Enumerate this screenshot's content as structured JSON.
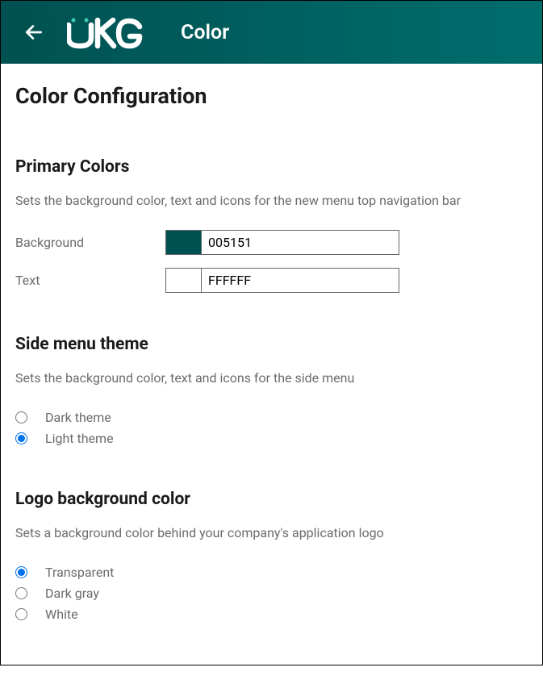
{
  "header": {
    "title": "Color",
    "brand_color": "#005151"
  },
  "page": {
    "title": "Color Configuration"
  },
  "sections": {
    "primary": {
      "title": "Primary Colors",
      "desc": "Sets the background color, text and icons for the new menu top navigation bar",
      "fields": {
        "background": {
          "label": "Background",
          "value": "005151",
          "swatch": "#005151"
        },
        "text": {
          "label": "Text",
          "value": "FFFFFF",
          "swatch": "#FFFFFF"
        }
      }
    },
    "sidemenu": {
      "title": "Side menu theme",
      "desc": "Sets the background color, text and icons for the side menu",
      "options": {
        "dark": "Dark theme",
        "light": "Light theme"
      },
      "selected": "light"
    },
    "logobg": {
      "title": "Logo background color",
      "desc": "Sets a background color behind your company's application logo",
      "options": {
        "transparent": "Transparent",
        "darkgray": "Dark gray",
        "white": "White"
      },
      "selected": "transparent"
    }
  }
}
